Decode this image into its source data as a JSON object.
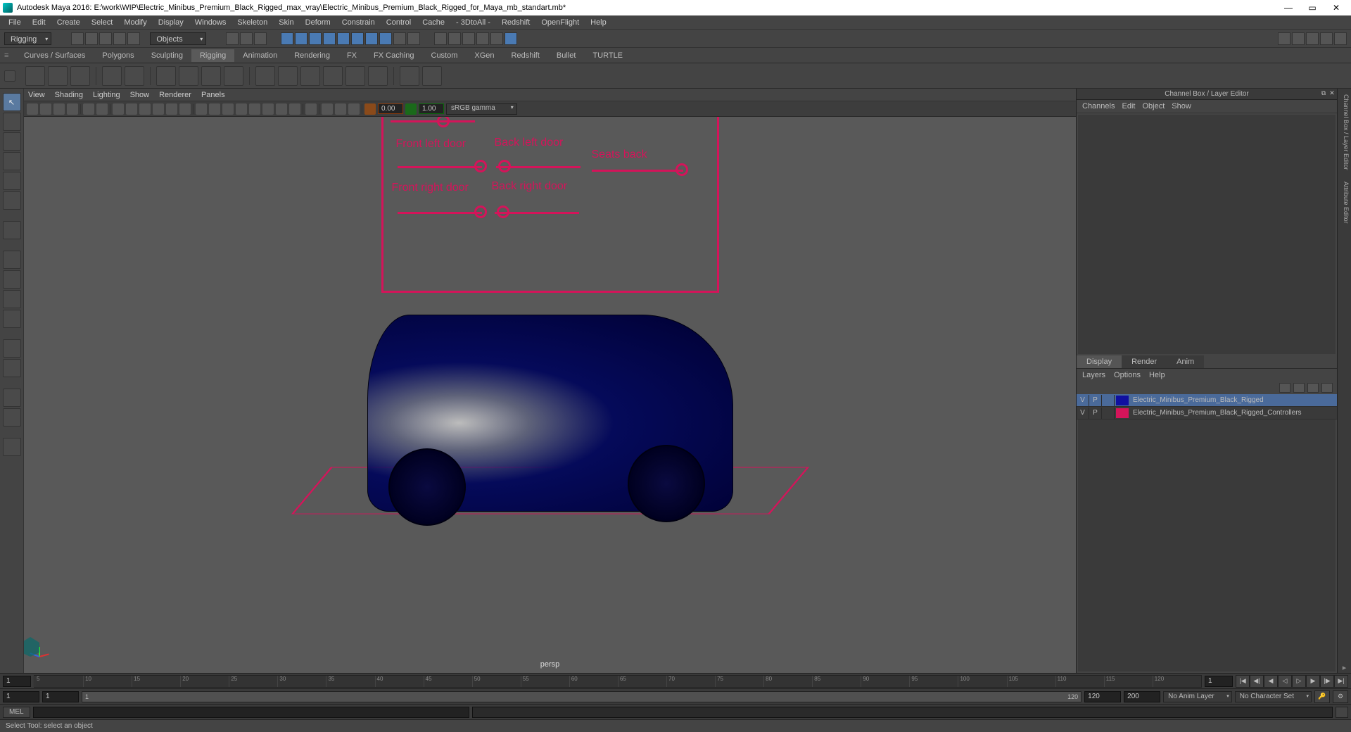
{
  "title": "Autodesk Maya 2016: E:\\work\\WIP\\Electric_Minibus_Premium_Black_Rigged_max_vray\\Electric_Minibus_Premium_Black_Rigged_for_Maya_mb_standart.mb*",
  "main_menu": [
    "File",
    "Edit",
    "Create",
    "Select",
    "Modify",
    "Display",
    "Windows",
    "Skeleton",
    "Skin",
    "Deform",
    "Constrain",
    "Control",
    "Cache",
    "- 3DtoAll -",
    "Redshift",
    "OpenFlight",
    "Help"
  ],
  "workspace": "Rigging",
  "mask_label": "Objects",
  "shelf_tabs": [
    "Curves / Surfaces",
    "Polygons",
    "Sculpting",
    "Rigging",
    "Animation",
    "Rendering",
    "FX",
    "FX Caching",
    "Custom",
    "XGen",
    "Redshift",
    "Bullet",
    "TURTLE"
  ],
  "active_shelf_tab": "Rigging",
  "panel_menu": [
    "View",
    "Shading",
    "Lighting",
    "Show",
    "Renderer",
    "Panels"
  ],
  "exposure": "0.00",
  "gamma": "1.00",
  "colorspace": "sRGB gamma",
  "camera": "persp",
  "rig": {
    "front_left": "Front left door",
    "back_left": "Back left door",
    "front_right": "Front right door",
    "back_right": "Back right door",
    "seats": "Seats back"
  },
  "channel_box": {
    "title": "Channel Box / Layer Editor",
    "menu": [
      "Channels",
      "Edit",
      "Object",
      "Show"
    ],
    "tabs": [
      "Display",
      "Render",
      "Anim"
    ],
    "layers_menu": [
      "Layers",
      "Options",
      "Help"
    ],
    "layers": [
      {
        "v": "V",
        "p": "P",
        "color": "#1010a0",
        "name": "Electric_Minibus_Premium_Black_Rigged",
        "sel": true
      },
      {
        "v": "V",
        "p": "P",
        "color": "#d4145a",
        "name": "Electric_Minibus_Premium_Black_Rigged_Controllers",
        "sel": false
      }
    ]
  },
  "right_docks": [
    "Channel Box / Layer Editor",
    "Attribute Editor"
  ],
  "timeline": {
    "start_frame": "1",
    "current_frame": "1",
    "ticks": [
      "5",
      "10",
      "15",
      "20",
      "25",
      "30",
      "35",
      "40",
      "45",
      "50",
      "55",
      "60",
      "65",
      "70",
      "75",
      "80",
      "85",
      "90",
      "95",
      "100",
      "105",
      "110",
      "115",
      "120"
    ]
  },
  "range": {
    "anim_start": "1",
    "range_start": "1",
    "range_end": "120",
    "anim_end": "120",
    "fps": "200",
    "anim_layer": "No Anim Layer",
    "character_set": "No Character Set"
  },
  "cmd_label": "MEL",
  "help_line": "Select Tool: select an object"
}
